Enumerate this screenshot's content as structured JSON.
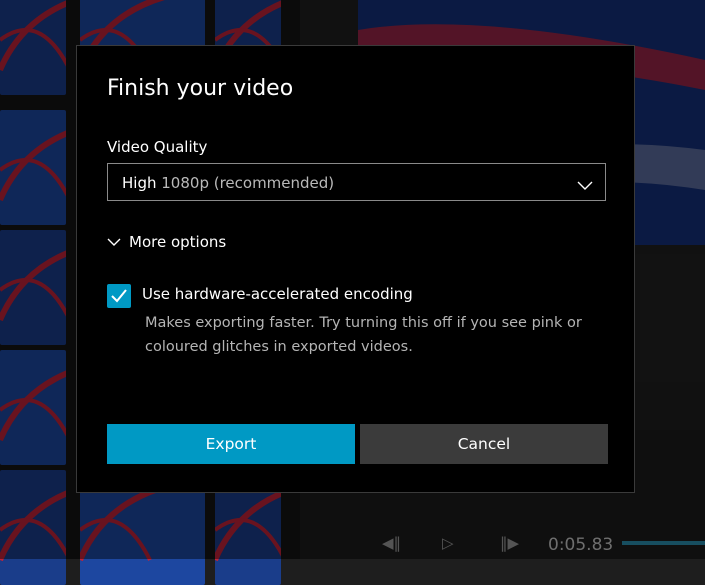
{
  "dialog": {
    "title": "Finish your video",
    "quality_label": "Video Quality",
    "quality_value_main": "High",
    "quality_value_sub": "1080p (recommended)",
    "more_options_label": "More options",
    "hw_encoding": {
      "checked": true,
      "label": "Use hardware-accelerated encoding",
      "description": "Makes exporting faster. Try turning this off if you see pink or coloured glitches in exported videos."
    },
    "export_label": "Export",
    "cancel_label": "Cancel"
  },
  "player": {
    "time": "0:05.83"
  },
  "colors": {
    "accent": "#0099c4",
    "dialog_bg": "#000000",
    "cancel_bg": "#3b3b3b"
  },
  "icons": [
    "chevron-down-icon",
    "checkmark-icon",
    "previous-frame-icon",
    "play-icon",
    "next-frame-icon"
  ]
}
